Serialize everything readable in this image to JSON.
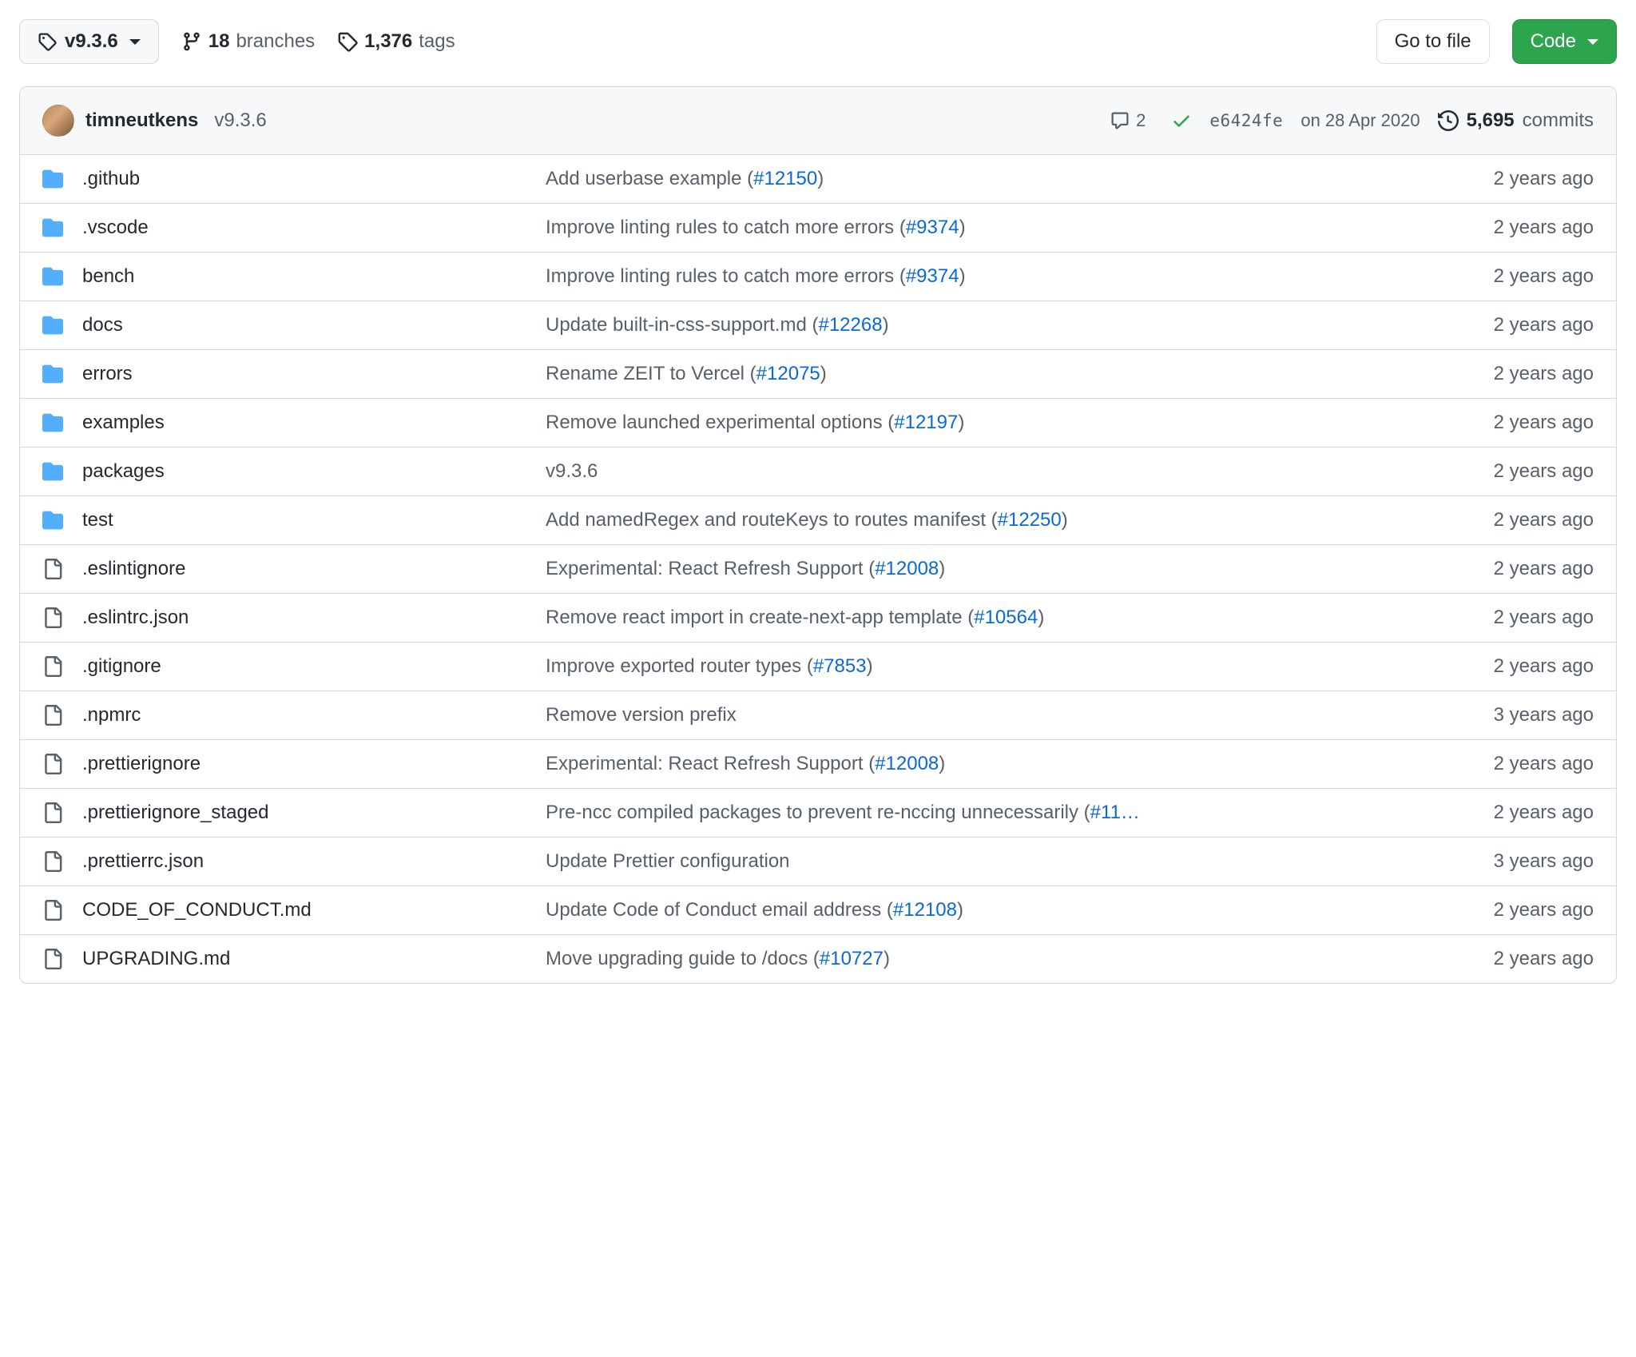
{
  "toolbar": {
    "ref_label": "v9.3.6",
    "branches_count": "18",
    "branches_label": "branches",
    "tags_count": "1,376",
    "tags_label": "tags",
    "goto_file_label": "Go to file",
    "code_label": "Code"
  },
  "commit_bar": {
    "author": "timneutkens",
    "message": "v9.3.6",
    "comment_count": "2",
    "sha": "e6424fe",
    "date": "on 28 Apr 2020",
    "commits_count": "5,695",
    "commits_label": "commits"
  },
  "files": [
    {
      "type": "dir",
      "name": ".github",
      "msg": "Add userbase example (",
      "pr": "#12150",
      "msg_tail": ")",
      "time": "2 years ago"
    },
    {
      "type": "dir",
      "name": ".vscode",
      "msg": "Improve linting rules to catch more errors (",
      "pr": "#9374",
      "msg_tail": ")",
      "time": "2 years ago"
    },
    {
      "type": "dir",
      "name": "bench",
      "msg": "Improve linting rules to catch more errors (",
      "pr": "#9374",
      "msg_tail": ")",
      "time": "2 years ago"
    },
    {
      "type": "dir",
      "name": "docs",
      "msg": "Update built-in-css-support.md (",
      "pr": "#12268",
      "msg_tail": ")",
      "time": "2 years ago"
    },
    {
      "type": "dir",
      "name": "errors",
      "msg": "Rename ZEIT to Vercel (",
      "pr": "#12075",
      "msg_tail": ")",
      "time": "2 years ago"
    },
    {
      "type": "dir",
      "name": "examples",
      "msg": "Remove launched experimental options (",
      "pr": "#12197",
      "msg_tail": ")",
      "time": "2 years ago"
    },
    {
      "type": "dir",
      "name": "packages",
      "msg": "v9.3.6",
      "pr": "",
      "msg_tail": "",
      "time": "2 years ago"
    },
    {
      "type": "dir",
      "name": "test",
      "msg": "Add namedRegex and routeKeys to routes manifest (",
      "pr": "#12250",
      "msg_tail": ")",
      "time": "2 years ago"
    },
    {
      "type": "file",
      "name": ".eslintignore",
      "msg": "Experimental: React Refresh Support (",
      "pr": "#12008",
      "msg_tail": ")",
      "time": "2 years ago"
    },
    {
      "type": "file",
      "name": ".eslintrc.json",
      "msg": "Remove react import in create-next-app template (",
      "pr": "#10564",
      "msg_tail": ")",
      "time": "2 years ago"
    },
    {
      "type": "file",
      "name": ".gitignore",
      "msg": "Improve exported router types (",
      "pr": "#7853",
      "msg_tail": ")",
      "time": "2 years ago"
    },
    {
      "type": "file",
      "name": ".npmrc",
      "msg": "Remove version prefix",
      "pr": "",
      "msg_tail": "",
      "time": "3 years ago"
    },
    {
      "type": "file",
      "name": ".prettierignore",
      "msg": "Experimental: React Refresh Support (",
      "pr": "#12008",
      "msg_tail": ")",
      "time": "2 years ago"
    },
    {
      "type": "file",
      "name": ".prettierignore_staged",
      "msg": "Pre-ncc compiled packages to prevent re-nccing unnecessarily (",
      "pr": "#11…",
      "msg_tail": "",
      "time": "2 years ago"
    },
    {
      "type": "file",
      "name": ".prettierrc.json",
      "msg": "Update Prettier configuration",
      "pr": "",
      "msg_tail": "",
      "time": "3 years ago"
    },
    {
      "type": "file",
      "name": "CODE_OF_CONDUCT.md",
      "msg": "Update Code of Conduct email address (",
      "pr": "#12108",
      "msg_tail": ")",
      "time": "2 years ago"
    },
    {
      "type": "file",
      "name": "UPGRADING.md",
      "msg": "Move upgrading guide to /docs (",
      "pr": "#10727",
      "msg_tail": ")",
      "time": "2 years ago"
    }
  ]
}
